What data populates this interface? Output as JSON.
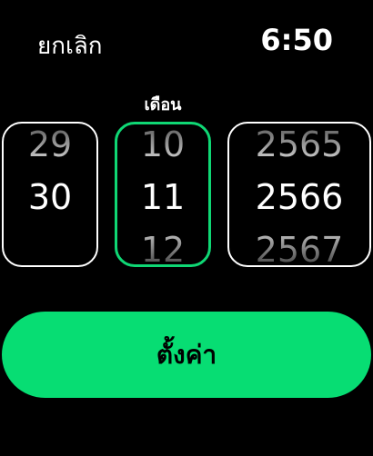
{
  "header": {
    "cancel_label": "ยกเลิก",
    "time": "6:50"
  },
  "focused_column_label": "เดือน",
  "pickers": {
    "day": {
      "prev": "29",
      "selected": "30",
      "next": ""
    },
    "month": {
      "prev": "10",
      "selected": "11",
      "next": "12"
    },
    "year": {
      "prev": "2565",
      "selected": "2566",
      "next": "2567"
    }
  },
  "set_button_label": "ตั้งค่า",
  "colors": {
    "accent": "#07dd73",
    "focus_border": "#0fd774"
  }
}
